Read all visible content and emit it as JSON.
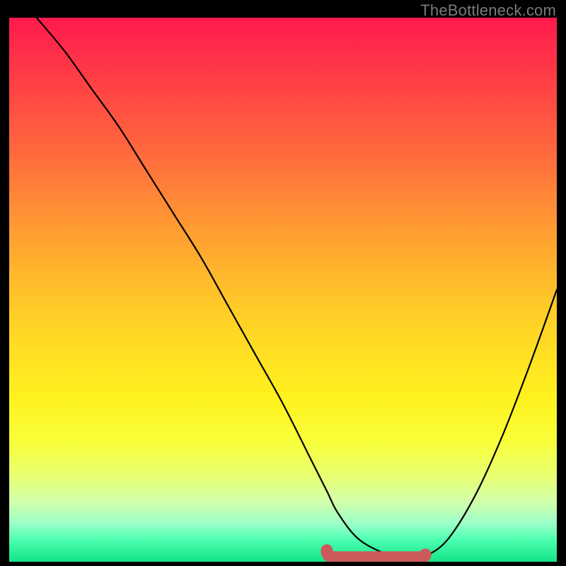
{
  "watermark": "TheBottleneck.com",
  "chart_data": {
    "type": "line",
    "title": "",
    "xlabel": "",
    "ylabel": "",
    "xlim": [
      0,
      100
    ],
    "ylim": [
      0,
      100
    ],
    "series": [
      {
        "name": "curve",
        "x": [
          5,
          10,
          15,
          20,
          25,
          30,
          35,
          40,
          45,
          50,
          55,
          58,
          60,
          64,
          70,
          74,
          76,
          80,
          85,
          90,
          95,
          100
        ],
        "y": [
          100,
          94,
          87,
          80,
          72,
          64,
          56,
          47,
          38,
          29,
          19,
          13,
          9,
          4,
          1,
          0.5,
          1,
          4,
          12,
          23,
          36,
          50
        ]
      }
    ],
    "marker": {
      "name": "optimal-range",
      "x_start": 58,
      "x_end": 76,
      "y": 0.8,
      "color": "#cc5a5a"
    }
  }
}
